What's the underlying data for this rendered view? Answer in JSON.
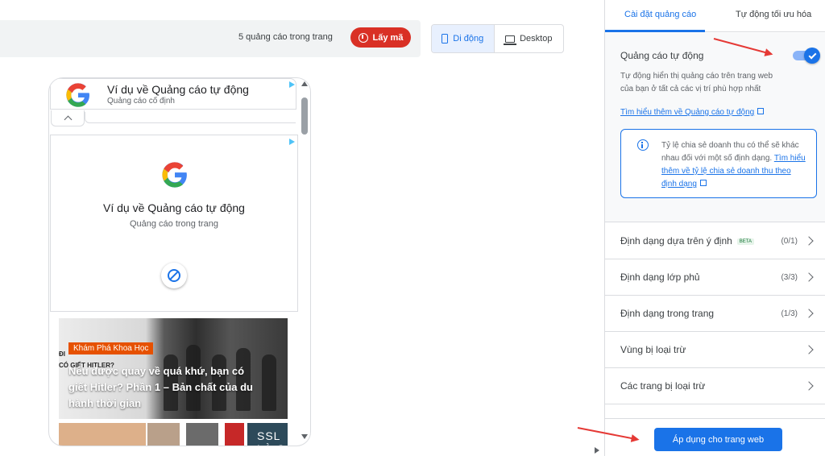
{
  "toolbar": {
    "ad_count": "5 quảng cáo trong trang",
    "get_code": "Lấy mã",
    "mobile": "Di động",
    "desktop": "Desktop"
  },
  "preview": {
    "anchor_title": "Ví dụ về Quảng cáo tự động",
    "anchor_sub": "Quảng cáo cố định",
    "inpage_title": "Ví dụ về Quảng cáo tự động",
    "inpage_sub": "Quảng cáo trong trang",
    "article_tag": "Khám Phá Khoa Học",
    "article_side_1": "ĐI",
    "article_side_2": "CÓ GIẾT HITLER?",
    "article_title": "Nếu được quay về quá khứ, bạn có giết Hitler? Phần 1 – Bản chất của du hành thời gian",
    "thumb_text": "SSL LÀ C"
  },
  "panel": {
    "tabs": [
      "Cài đặt quảng cáo",
      "Tự động tối ưu hóa"
    ],
    "auto_title": "Quảng cáo tự động",
    "auto_desc": "Tự động hiển thị quảng cáo trên trang web của bạn ở tất cả các vị trí phù hợp nhất",
    "auto_link": "Tìm hiểu thêm về Quảng cáo tự động",
    "info_text": "Tỷ lệ chia sẻ doanh thu có thể sẽ khác nhau đối với một số định dạng.",
    "info_link": "Tìm hiểu thêm về tỷ lệ chia sẻ doanh thu theo định dạng",
    "rows": [
      {
        "label": "Định dạng dựa trên ý định",
        "badge": "BETA",
        "count": "(0/1)"
      },
      {
        "label": "Định dạng lớp phủ",
        "count": "(3/3)"
      },
      {
        "label": "Định dạng trong trang",
        "count": "(1/3)"
      },
      {
        "label": "Vùng bị loại trừ",
        "count": ""
      },
      {
        "label": "Các trang bị loại trừ",
        "count": ""
      }
    ],
    "apply": "Áp dụng cho trang web"
  },
  "colors": {
    "accent": "#1a73e8",
    "danger": "#d93025",
    "annotation_arrow": "#e53935"
  }
}
